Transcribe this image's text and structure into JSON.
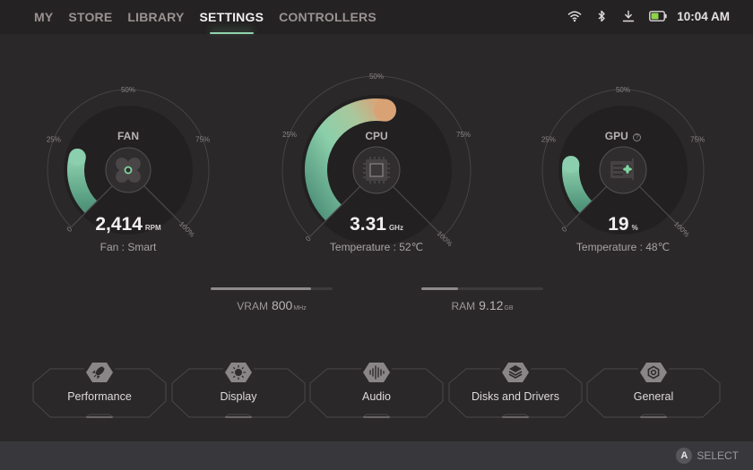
{
  "nav": {
    "tabs": [
      {
        "label": "MY",
        "active": false
      },
      {
        "label": "STORE",
        "active": false
      },
      {
        "label": "LIBRARY",
        "active": false
      },
      {
        "label": "SETTINGS",
        "active": true
      },
      {
        "label": "CONTROLLERS",
        "active": false
      }
    ]
  },
  "status": {
    "icons": [
      "wifi-icon",
      "bluetooth-icon",
      "download-icon",
      "battery-icon"
    ],
    "battery_color": "#8fd44a",
    "time": "10:04 AM"
  },
  "gauges": {
    "tick_labels": [
      "0",
      "25%",
      "50%",
      "75%",
      "100%"
    ],
    "fan": {
      "title": "FAN",
      "value": "2,414",
      "unit": "RPM",
      "subtitle": "Fan : Smart",
      "fill_fraction": 0.22,
      "icon": "fan-icon"
    },
    "cpu": {
      "title": "CPU",
      "value": "3.31",
      "unit": "GHz",
      "subtitle": "Temperature : 52℃",
      "fill_fraction": 0.53,
      "icon": "cpu-chip-icon"
    },
    "gpu": {
      "title": "GPU",
      "help_icon": "?",
      "value": "19",
      "unit": "%",
      "subtitle": "Temperature : 48℃",
      "fill_fraction": 0.19,
      "icon": "graphics-card-icon"
    },
    "colors": {
      "arc_start": "#5aa88a",
      "arc_mid": "#8ccfae",
      "arc_end_cpu": "#d9a275",
      "accent": "#7fd49f"
    }
  },
  "memory": {
    "vram": {
      "label": "VRAM",
      "value": "800",
      "unit": "MHz",
      "fill_fraction": 0.82
    },
    "ram": {
      "label": "RAM",
      "value": "9.12",
      "unit": "GB",
      "fill_fraction": 0.3
    }
  },
  "categories": [
    {
      "label": "Performance",
      "icon": "rocket-icon"
    },
    {
      "label": "Display",
      "icon": "brightness-icon"
    },
    {
      "label": "Audio",
      "icon": "sound-wave-icon"
    },
    {
      "label": "Disks and Drivers",
      "icon": "layers-icon"
    },
    {
      "label": "General",
      "icon": "settings-nut-icon"
    }
  ],
  "footer": {
    "button_glyph": "A",
    "hint": "SELECT"
  }
}
